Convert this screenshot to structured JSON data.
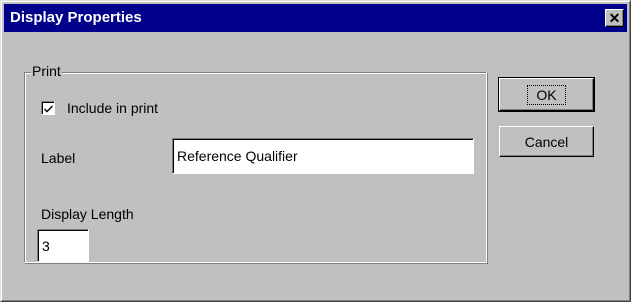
{
  "window": {
    "title": "Display Properties",
    "close_glyph": "✕"
  },
  "print_group": {
    "legend": "Print",
    "include_in_print": {
      "label": "Include in print",
      "checked": true
    },
    "label_caption": "Label",
    "label_value": "Reference Qualifier",
    "display_length_caption": "Display Length",
    "display_length_value": "3"
  },
  "buttons": {
    "ok": "OK",
    "cancel": "Cancel"
  },
  "icons": {
    "close": "close-icon",
    "check": "checkmark-icon"
  }
}
